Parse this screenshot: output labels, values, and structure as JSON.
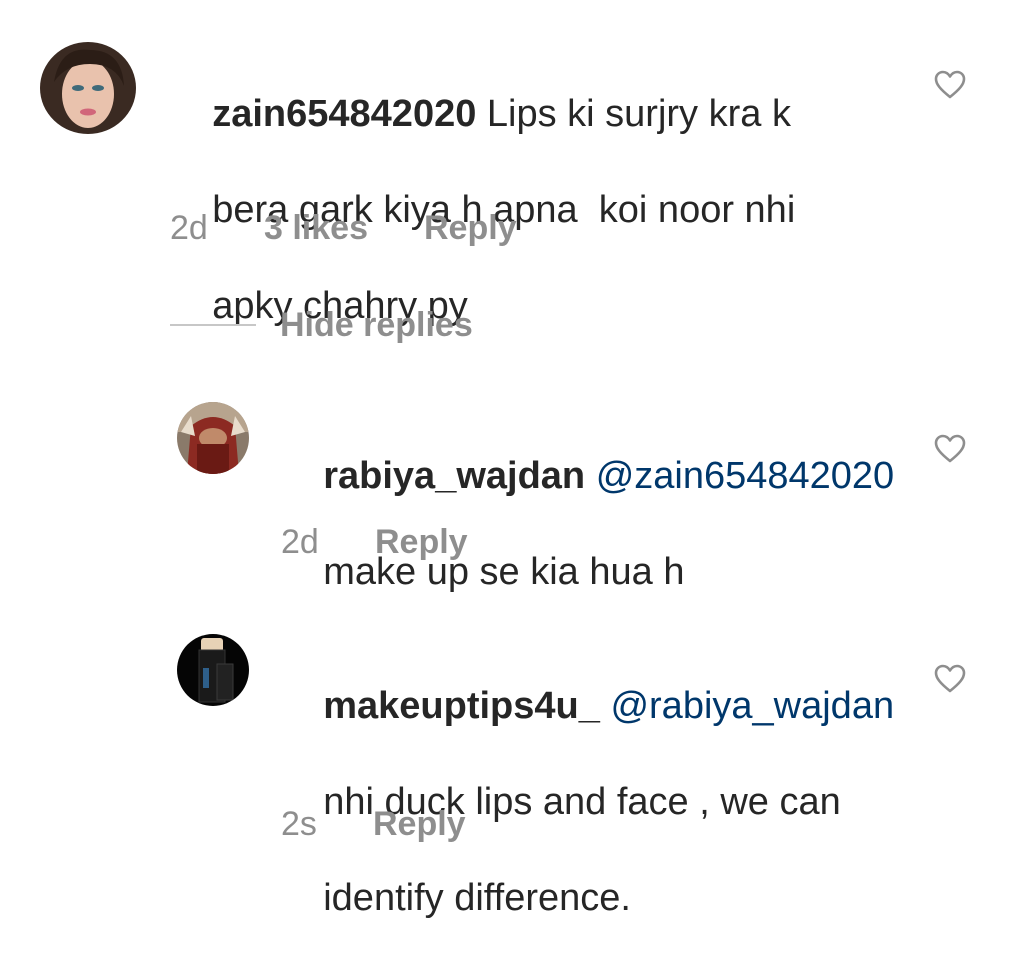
{
  "comments": [
    {
      "username": "zain654842020",
      "mention": "",
      "text_line1": " Lips ki surjry kra k",
      "text_line2": "bera gark kiya h apna  koi noor nhi",
      "text_line3": "apky chahry py",
      "time": "2d",
      "likes": "3 likes",
      "reply": "Reply",
      "avatar_icon": "profile-photo-woman"
    },
    {
      "username": "rabiya_wajdan",
      "mention": "@zain654842020",
      "text_line1": "make up se kia hua h",
      "time": "2d",
      "reply": "Reply",
      "avatar_icon": "profile-photo-masked"
    },
    {
      "username": "makeuptips4u_",
      "mention": "@rabiya_wajdan",
      "text_line1": "nhi duck lips and face , we can",
      "text_line2": "identify difference.",
      "time": "2s",
      "reply": "Reply",
      "avatar_icon": "profile-photo-makeup-stick"
    }
  ],
  "thread": {
    "hide_replies_label": "Hide replies"
  },
  "colors": {
    "text": "#262626",
    "secondary": "#8e8e8e",
    "mention": "#00376b"
  }
}
